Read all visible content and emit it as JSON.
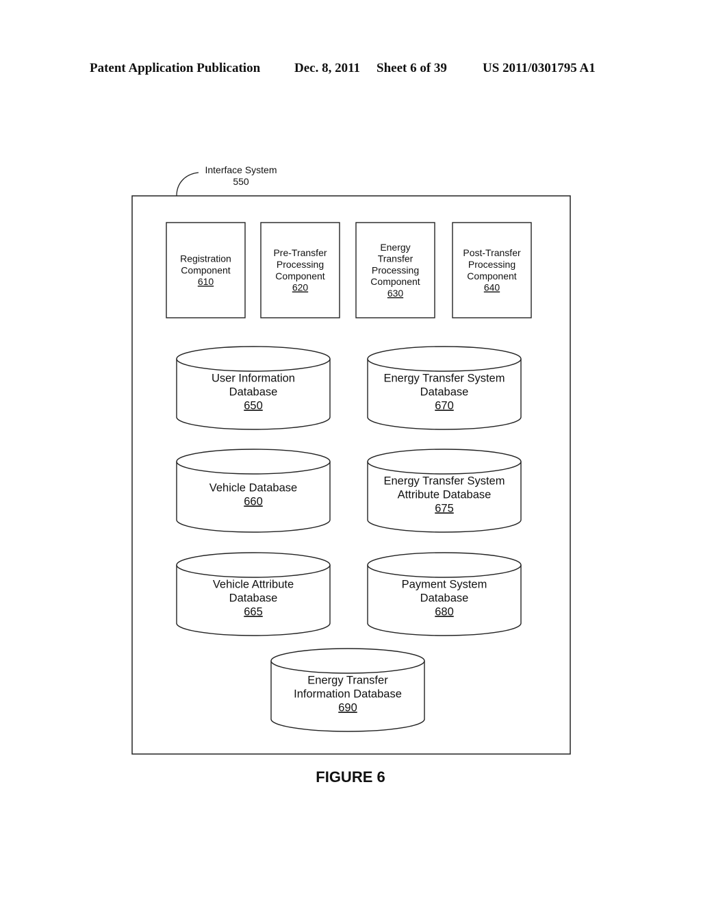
{
  "header": {
    "publication": "Patent Application Publication",
    "date": "Dec. 8, 2011",
    "sheet": "Sheet 6 of 39",
    "number": "US 2011/0301795 A1"
  },
  "system": {
    "name": "Interface System",
    "ref": "550"
  },
  "components": [
    {
      "lines": [
        "Registration",
        "Component"
      ],
      "ref": "610"
    },
    {
      "lines": [
        "Pre-Transfer",
        "Processing",
        "Component"
      ],
      "ref": "620"
    },
    {
      "lines": [
        "Energy",
        "Transfer",
        "Processing",
        "Component"
      ],
      "ref": "630"
    },
    {
      "lines": [
        "Post-Transfer",
        "Processing",
        "Component"
      ],
      "ref": "640"
    }
  ],
  "databases": [
    {
      "lines": [
        "User Information",
        "Database"
      ],
      "ref": "650"
    },
    {
      "lines": [
        "Energy Transfer System",
        "Database"
      ],
      "ref": "670"
    },
    {
      "lines": [
        "Vehicle Database"
      ],
      "ref": "660"
    },
    {
      "lines": [
        "Energy Transfer System",
        "Attribute Database"
      ],
      "ref": "675"
    },
    {
      "lines": [
        "Vehicle Attribute",
        "Database"
      ],
      "ref": "665"
    },
    {
      "lines": [
        "Payment System",
        "Database"
      ],
      "ref": "680"
    },
    {
      "lines": [
        "Energy Transfer",
        "Information Database"
      ],
      "ref": "690"
    }
  ],
  "figure_label": "FIGURE 6"
}
